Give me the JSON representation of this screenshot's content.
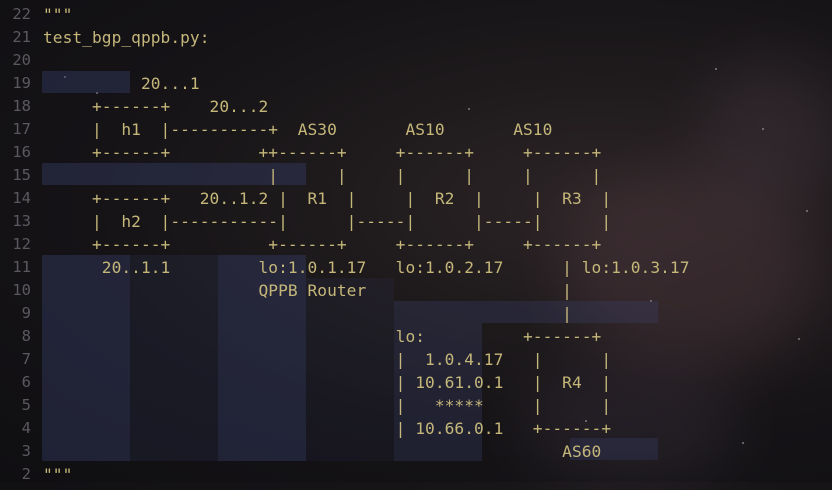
{
  "editor": {
    "colors": {
      "code_text": "#c5b77a",
      "line_number": "#5b5860",
      "highlight": "#3a4370"
    },
    "lines": [
      {
        "num": "22",
        "text": "\"\"\""
      },
      {
        "num": "21",
        "text": "test_bgp_qppb.py:"
      },
      {
        "num": "20",
        "text": ""
      },
      {
        "num": "19",
        "text": "          20...1"
      },
      {
        "num": "18",
        "text": "     +------+    20...2"
      },
      {
        "num": "17",
        "text": "     |  h1  |----------+  AS30       AS10       AS10"
      },
      {
        "num": "16",
        "text": "     +------+         ++------+     +------+     +------+"
      },
      {
        "num": "15",
        "text": "                       |      |     |      |     |      |"
      },
      {
        "num": "14",
        "text": "     +------+   20..1.2 |  R1  |     |  R2  |     |  R3  |"
      },
      {
        "num": "13",
        "text": "     |  h2  |-----------|      |-----|      |-----|      |"
      },
      {
        "num": "12",
        "text": "     +------+          +------+     +------+     +------+"
      },
      {
        "num": "11",
        "text": "      20..1.1         lo:1.0.1.17   lo:1.0.2.17      | lo:1.0.3.17"
      },
      {
        "num": "10",
        "text": "                      QPPB Router                    |"
      },
      {
        "num": "9",
        "text": "                                                     |"
      },
      {
        "num": "8",
        "text": "                                    lo:          +------+"
      },
      {
        "num": "7",
        "text": "                                    |  1.0.4.17   |      |"
      },
      {
        "num": "6",
        "text": "                                    | 10.61.0.1   |  R4  |"
      },
      {
        "num": "5",
        "text": "                                    |   *****     |      |"
      },
      {
        "num": "4",
        "text": "                                    | 10.66.0.1   +------+"
      },
      {
        "num": "3",
        "text": "                                                     AS60"
      },
      {
        "num": "2",
        "text": "\"\"\""
      }
    ]
  }
}
